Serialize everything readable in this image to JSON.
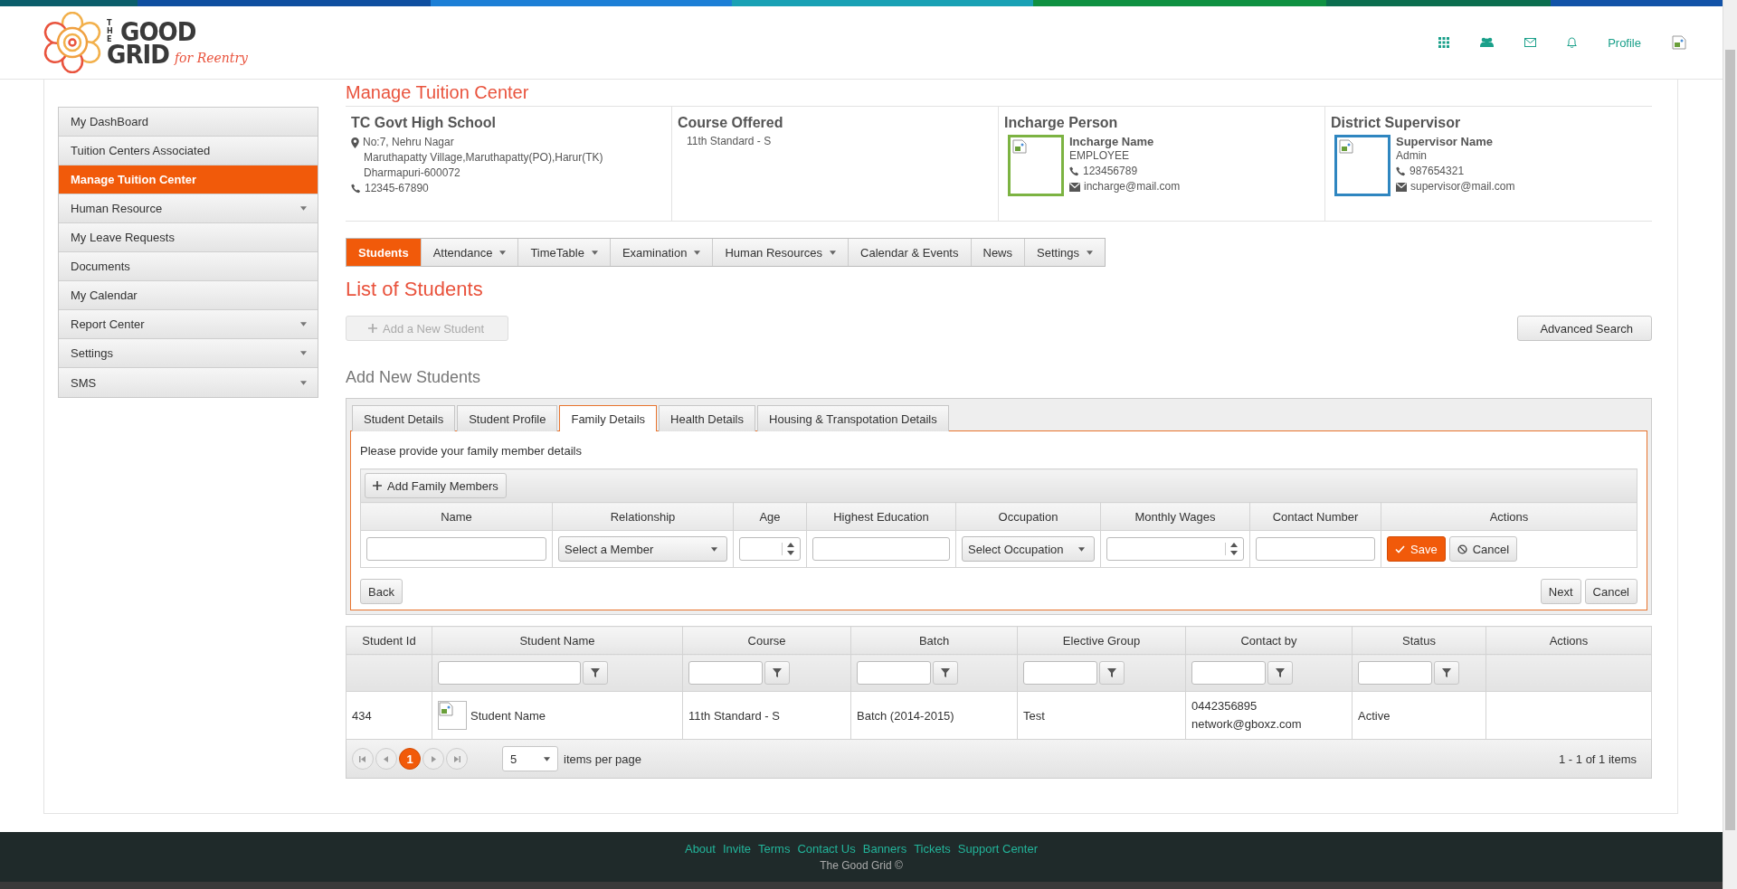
{
  "header": {
    "logo": {
      "small": "THE",
      "line1": "GOOD",
      "line2": "GRID",
      "tagline": "for Reentry"
    },
    "profile_link": "Profile"
  },
  "page_title": "Manage Tuition Center",
  "sidebar": {
    "items": [
      {
        "label": "My DashBoard",
        "selected": false,
        "has_submenu": false
      },
      {
        "label": "Tuition Centers Associated",
        "selected": false,
        "has_submenu": false
      },
      {
        "label": "Manage Tuition Center",
        "selected": true,
        "has_submenu": false
      },
      {
        "label": "Human Resource",
        "selected": false,
        "has_submenu": true
      },
      {
        "label": "My Leave Requests",
        "selected": false,
        "has_submenu": false
      },
      {
        "label": "Documents",
        "selected": false,
        "has_submenu": false
      },
      {
        "label": "My Calendar",
        "selected": false,
        "has_submenu": false
      },
      {
        "label": "Report Center",
        "selected": false,
        "has_submenu": true
      },
      {
        "label": "Settings",
        "selected": false,
        "has_submenu": true
      },
      {
        "label": "SMS",
        "selected": false,
        "has_submenu": true
      }
    ]
  },
  "info": {
    "center": {
      "name": "TC Govt High School",
      "address": [
        "No:7, Nehru Nagar",
        "Maruthapatty Village,Maruthapatty(PO),Harur(TK)",
        "Dharmapuri-600072"
      ],
      "phone": "12345-67890"
    },
    "course": {
      "title": "Course Offered",
      "value": "11th Standard - S"
    },
    "contacts": [
      {
        "title": "Incharge Person",
        "name": "Incharge Name",
        "role": "EMPLOYEE",
        "phone": "123456789",
        "email": "incharge@mail.com",
        "color": "#7cb342"
      },
      {
        "title": "District Supervisor",
        "name": "Supervisor Name",
        "role": "Admin",
        "phone": "987654321",
        "email": "supervisor@mail.com",
        "color": "#2f86c0"
      }
    ]
  },
  "module_tabs": [
    {
      "label": "Students",
      "selected": true,
      "has_menu": false
    },
    {
      "label": "Attendance",
      "selected": false,
      "has_menu": true
    },
    {
      "label": "TimeTable",
      "selected": false,
      "has_menu": true
    },
    {
      "label": "Examination",
      "selected": false,
      "has_menu": true
    },
    {
      "label": "Human Resources",
      "selected": false,
      "has_menu": true
    },
    {
      "label": "Calendar & Events",
      "selected": false,
      "has_menu": false
    },
    {
      "label": "News",
      "selected": false,
      "has_menu": false
    },
    {
      "label": "Settings",
      "selected": false,
      "has_menu": true
    }
  ],
  "list_title": "List of Students",
  "add_student_button": {
    "label": "Add a New Student",
    "disabled": true
  },
  "advanced_search_button": "Advanced Search",
  "form": {
    "title": "Add New Students",
    "tabs": [
      {
        "label": "Student Details",
        "selected": false
      },
      {
        "label": "Student Profile",
        "selected": false
      },
      {
        "label": "Family Details",
        "selected": true
      },
      {
        "label": "Health Details",
        "selected": false
      },
      {
        "label": "Housing & Transpotation Details",
        "selected": false
      }
    ],
    "instruction": "Please provide your family member details",
    "add_members_button": "Add Family Members",
    "columns": [
      "Name",
      "Relationship",
      "Age",
      "Highest Education",
      "Occupation",
      "Monthly Wages",
      "Contact Number",
      "Actions"
    ],
    "entry_fields": [
      {
        "kind": "text"
      },
      {
        "kind": "select",
        "value": "Select a Member"
      },
      {
        "kind": "number"
      },
      {
        "kind": "text"
      },
      {
        "kind": "select",
        "value": "Select Occupation"
      },
      {
        "kind": "number"
      },
      {
        "kind": "text"
      }
    ],
    "entry_actions": [
      {
        "kind": "save",
        "label": "Save"
      },
      {
        "kind": "cancel",
        "label": "Cancel"
      }
    ],
    "back_button": "Back",
    "next_button": "Next",
    "cancel_button": "Cancel"
  },
  "students_table": {
    "columns": [
      {
        "label": "Student Id",
        "filterable": false
      },
      {
        "label": "Student Name",
        "filterable": true
      },
      {
        "label": "Course",
        "filterable": true
      },
      {
        "label": "Batch",
        "filterable": true
      },
      {
        "label": "Elective Group",
        "filterable": true
      },
      {
        "label": "Contact by",
        "filterable": true
      },
      {
        "label": "Status",
        "filterable": true
      },
      {
        "label": "Actions",
        "filterable": false
      }
    ],
    "rows": [
      {
        "id": "434",
        "name": "Student Name",
        "course": "11th Standard - S",
        "batch": "Batch (2014-2015)",
        "elective": "Test",
        "contact": [
          "0442356895",
          "network@gboxz.com"
        ],
        "status": "Active"
      }
    ],
    "pager": {
      "pages": [
        {
          "label": "1",
          "selected": true
        }
      ],
      "page_size": "5",
      "page_size_label": "items per page",
      "summary": "1 - 1 of 1 items"
    }
  },
  "footer": {
    "links": [
      "About",
      "Invite",
      "Terms",
      "Contact Us",
      "Banners",
      "Tickets",
      "Support Center"
    ],
    "copyright": "The Good Grid ©"
  }
}
